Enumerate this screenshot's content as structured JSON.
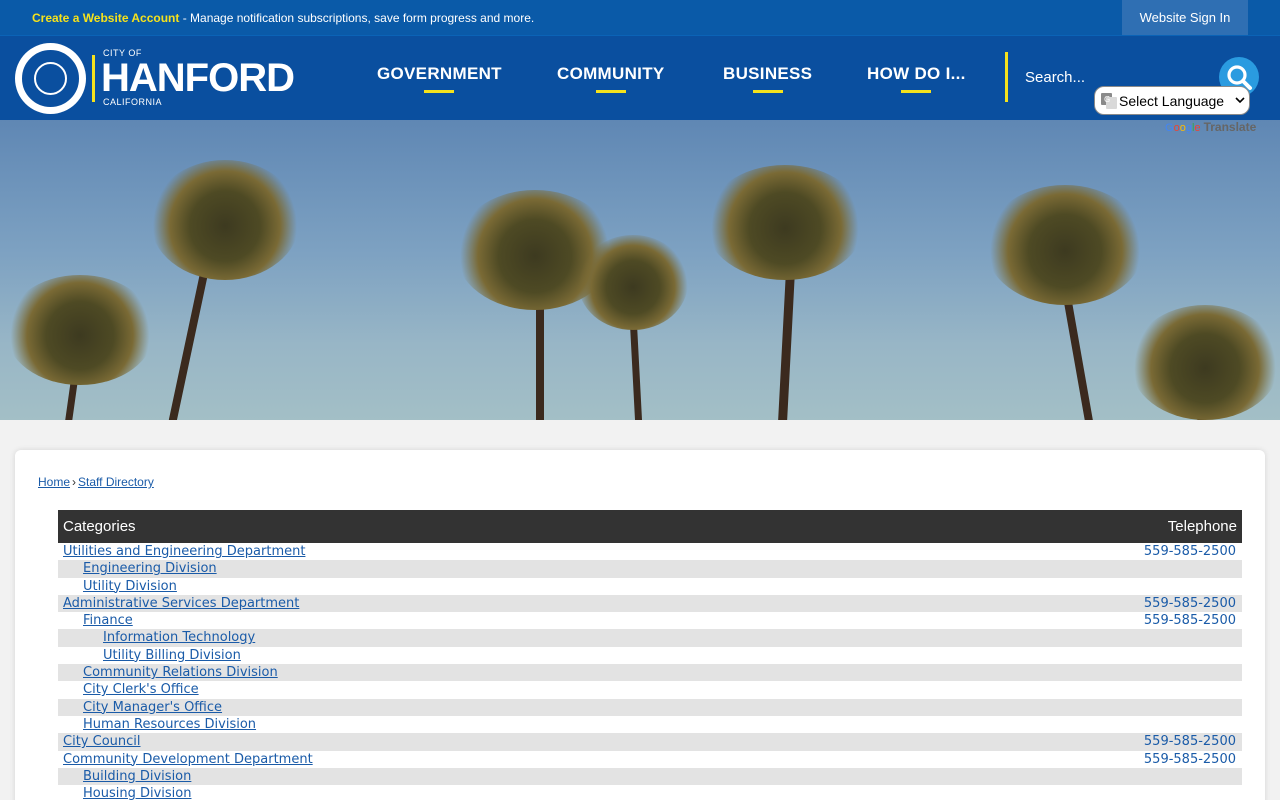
{
  "topbar": {
    "create_account_label": "Create a Website Account",
    "message": " - Manage notification subscriptions, save form progress and more.",
    "sign_in_label": "Website Sign In"
  },
  "logo": {
    "city_prefix": "CITY OF",
    "name": "HANFORD",
    "state": "CALIFORNIA"
  },
  "nav": {
    "items": [
      {
        "label": "GOVERNMENT"
      },
      {
        "label": "COMMUNITY"
      },
      {
        "label": "BUSINESS"
      },
      {
        "label": "HOW DO I..."
      }
    ]
  },
  "search": {
    "placeholder": "Search...",
    "icon": "search-icon"
  },
  "translate": {
    "select_label": "Select Language",
    "google_label": "Google",
    "translate_label": "Translate"
  },
  "breadcrumb": {
    "home": "Home",
    "separator": "›",
    "current": "Staff Directory"
  },
  "directory": {
    "col_categories": "Categories",
    "col_telephone": "Telephone",
    "rows": [
      {
        "name": "Utilities and Engineering Department",
        "level": 0,
        "phone": "559-585-2500"
      },
      {
        "name": "Engineering Division",
        "level": 1,
        "phone": ""
      },
      {
        "name": "Utility Division",
        "level": 1,
        "phone": ""
      },
      {
        "name": "Administrative Services Department",
        "level": 0,
        "phone": "559-585-2500"
      },
      {
        "name": "Finance",
        "level": 1,
        "phone": "559-585-2500"
      },
      {
        "name": "Information Technology",
        "level": 2,
        "phone": ""
      },
      {
        "name": "Utility Billing Division",
        "level": 2,
        "phone": ""
      },
      {
        "name": "Community Relations Division",
        "level": 1,
        "phone": ""
      },
      {
        "name": "City Clerk's Office",
        "level": 1,
        "phone": ""
      },
      {
        "name": "City Manager's Office",
        "level": 1,
        "phone": ""
      },
      {
        "name": "Human Resources Division",
        "level": 1,
        "phone": ""
      },
      {
        "name": "City Council",
        "level": 0,
        "phone": "559-585-2500"
      },
      {
        "name": "Community Development Department",
        "level": 0,
        "phone": "559-585-2500"
      },
      {
        "name": "Building Division",
        "level": 1,
        "phone": ""
      },
      {
        "name": "Housing Division",
        "level": 1,
        "phone": ""
      }
    ]
  },
  "colors": {
    "brand_blue": "#0a4f9f",
    "accent_yellow": "#f5e21c",
    "link_blue": "#1a5ba8"
  }
}
